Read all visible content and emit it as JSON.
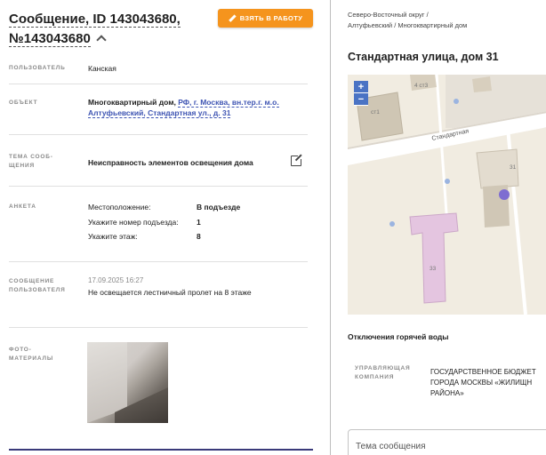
{
  "message": {
    "title": "Сообщение, ID 143043680, №143043680",
    "take_button": "ВЗЯТЬ В РАБОТУ"
  },
  "fields": {
    "user": {
      "label": "ПОЛЬЗОВАТЕЛЬ",
      "value": "Канская"
    },
    "object": {
      "label": "ОБЪЕКТ",
      "prefix": "Многоквартирный дом, ",
      "link": "РФ, г. Москва, вн.тер.г. м.о. Алтуфьевский, Стандартная ул., д. 31"
    },
    "topic": {
      "label": "ТЕМА СООБ-\nЩЕНИЯ",
      "value": "Неисправность элементов освещения дома"
    },
    "survey": {
      "label": "АНКЕТА",
      "rows": [
        {
          "q": "Местоположение:",
          "a": "В подъезде"
        },
        {
          "q": "Укажите номер подъезда:",
          "a": "1"
        },
        {
          "q": "Укажите этаж:",
          "a": "8"
        }
      ]
    },
    "user_message": {
      "label": "СООБЩЕНИЕ\nПОЛЬЗОВАТЕЛЯ",
      "date": "17.09.2025 16:27",
      "text": "Не освещается лестничный пролет на 8 этаже"
    },
    "photos": {
      "label": "ФОТО-\nМАТЕРИАЛЫ"
    }
  },
  "right": {
    "breadcrumb": "Северо-Восточный округ /\nАлтуфьевский / Многоквартирный дом",
    "address": "Стандартная улица, дом 31",
    "map": {
      "zoom_in": "+",
      "zoom_out": "−",
      "street": "Стандартная",
      "labels": [
        "4 ст3",
        "ст1",
        "31",
        "33"
      ]
    },
    "hot_water": "Отключения горячей воды",
    "uk": {
      "label": "УПРАВЛЯЮЩАЯ\nКОМПАНИЯ",
      "value": "ГОСУДАРСТВЕННОЕ БЮДЖЕТ\nГОРОДА МОСКВЫ «ЖИЛИЩН\nРАЙОНА»"
    },
    "subject_placeholder": "Тема сообщения"
  }
}
